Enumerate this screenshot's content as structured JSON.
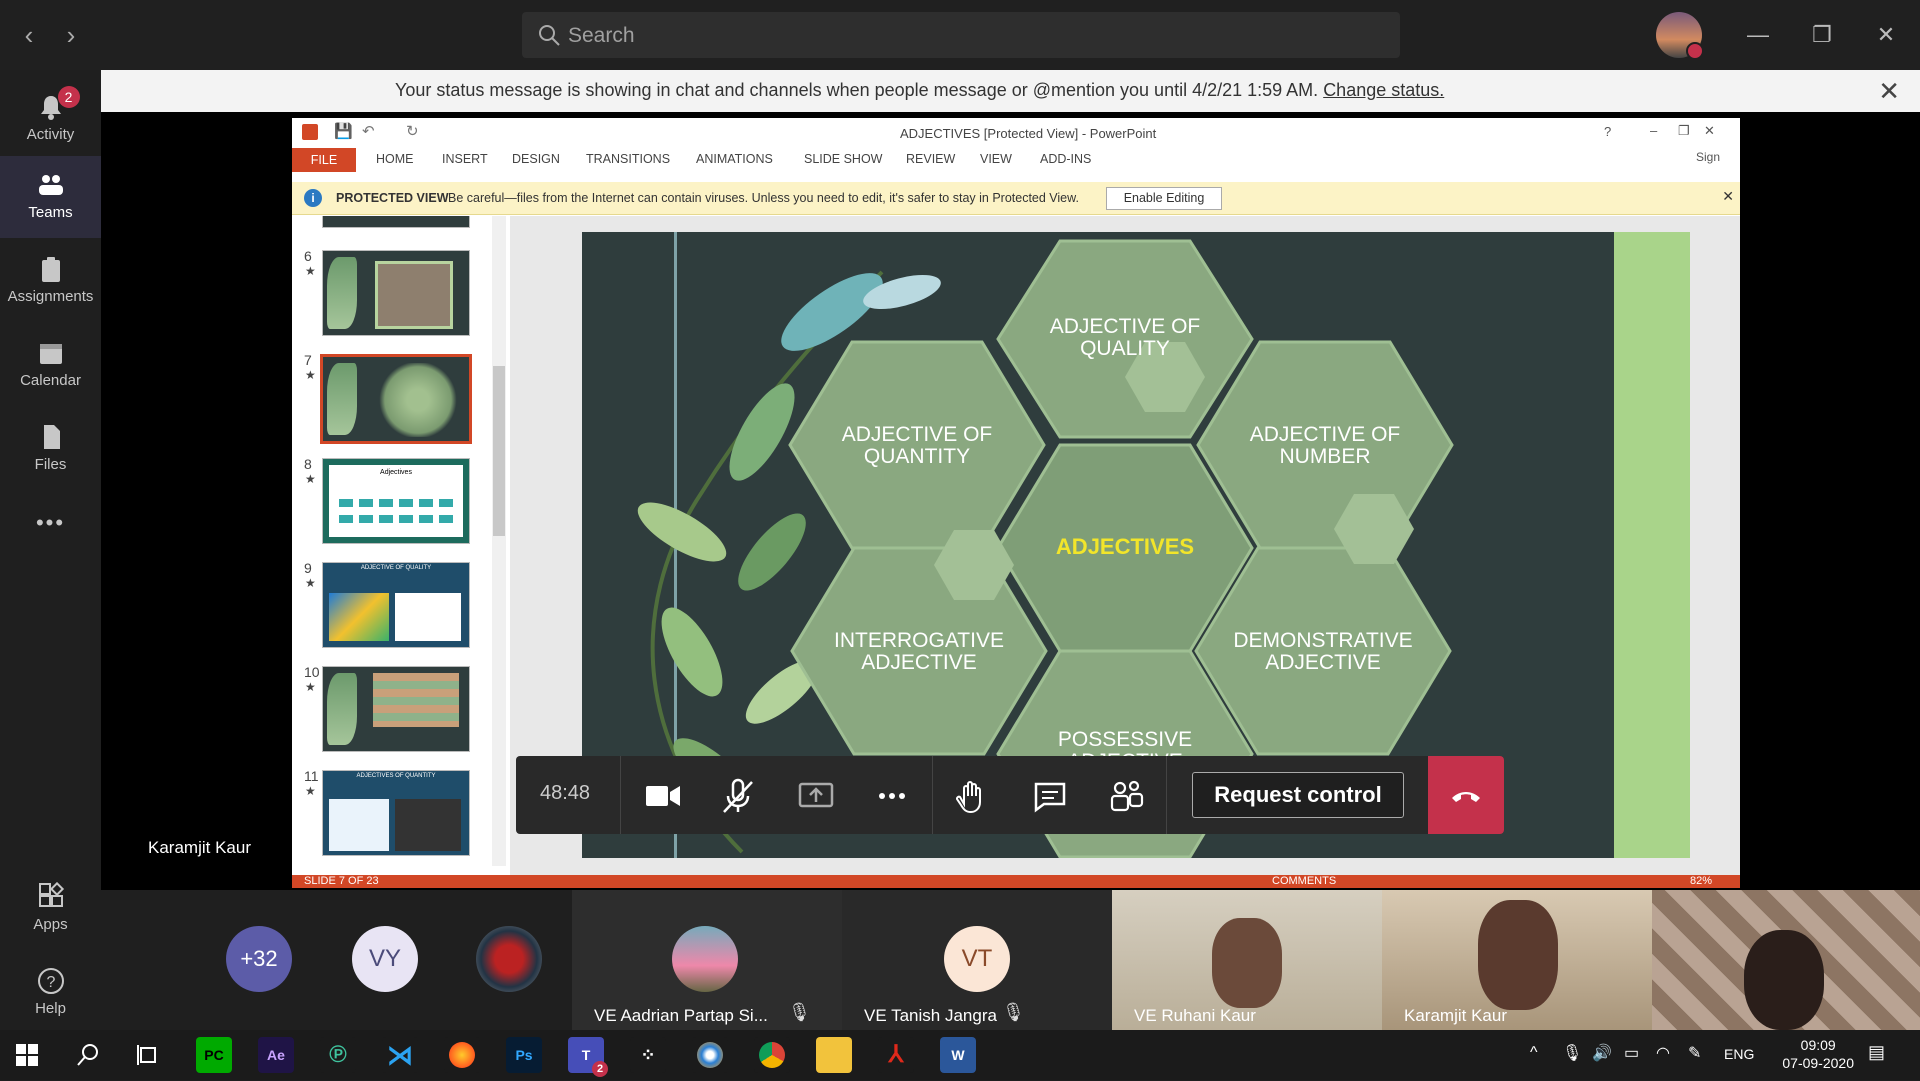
{
  "teams": {
    "search_placeholder": "Search",
    "rail": [
      {
        "label": "Activity",
        "icon": "bell-icon",
        "badge": "2"
      },
      {
        "label": "Teams",
        "icon": "teams-icon"
      },
      {
        "label": "Assignments",
        "icon": "assignments-icon"
      },
      {
        "label": "Calendar",
        "icon": "calendar-icon"
      },
      {
        "label": "Files",
        "icon": "files-icon"
      },
      {
        "label": "Apps",
        "icon": "apps-icon"
      },
      {
        "label": "Help",
        "icon": "help-icon"
      }
    ],
    "more": "•••",
    "banner_text": "Your status message is showing in chat and channels when people message or @mention you until 4/2/21 1:59 AM.",
    "banner_link": "Change status."
  },
  "ppt": {
    "window_title": "ADJECTIVES [Protected View] - PowerPoint",
    "sign_in": "Sign",
    "tabs": [
      "FILE",
      "HOME",
      "INSERT",
      "DESIGN",
      "TRANSITIONS",
      "ANIMATIONS",
      "SLIDE SHOW",
      "REVIEW",
      "VIEW",
      "ADD-INS"
    ],
    "protected_label": "PROTECTED VIEW",
    "protected_msg": "Be careful—files from the Internet can contain viruses. Unless you need to edit, it's safer to stay in Protected View.",
    "enable_editing": "Enable Editing",
    "thumbnails": [
      {
        "num": "6",
        "star": "★"
      },
      {
        "num": "7",
        "star": "★"
      },
      {
        "num": "8",
        "star": "★"
      },
      {
        "num": "9",
        "star": "★"
      },
      {
        "num": "10",
        "star": "★"
      },
      {
        "num": "11",
        "star": "★"
      }
    ],
    "thumb_texts": {
      "t8_title": "Adjectives",
      "t9_title": "ADJECTIVE OF QUALITY",
      "t11_title": "ADJECTIVES OF QUANTITY"
    },
    "slide_status": "SLIDE 7 OF 23",
    "comments": "COMMENTS",
    "zoom": "82%",
    "slide": {
      "center": "ADJECTIVES",
      "hexes": [
        "ADJECTIVE OF QUALITY",
        "ADJECTIVE OF QUANTITY",
        "ADJECTIVE OF NUMBER",
        "INTERROGATIVE ADJECTIVE",
        "DEMONSTRATIVE ADJECTIVE",
        "POSSESSIVE ADJECTIVE"
      ]
    }
  },
  "call": {
    "timer": "48:48",
    "request_control": "Request control",
    "presenter_name": "Karamjit Kaur",
    "overflow_count": "+32",
    "participants": [
      {
        "initials": "VY"
      },
      {
        "name": "VE Aadrian Partap Si..."
      },
      {
        "initials": "VT",
        "name": "VE Tanish Jangra"
      },
      {
        "name": "VE Ruhani Kaur"
      },
      {
        "name": "Karamjit Kaur"
      }
    ]
  },
  "taskbar": {
    "apps": [
      "PC",
      "Ae",
      "Ps"
    ],
    "teams_badge": "2",
    "lang": "ENG",
    "time": "09:09",
    "date": "07-09-2020"
  },
  "colors": {
    "accent_teams": "#6264a7",
    "ppt_orange": "#d24726",
    "hangup_red": "#c4314b",
    "slide_hex_green": "#8aa880",
    "slide_center_yellow": "#f2e52a"
  }
}
